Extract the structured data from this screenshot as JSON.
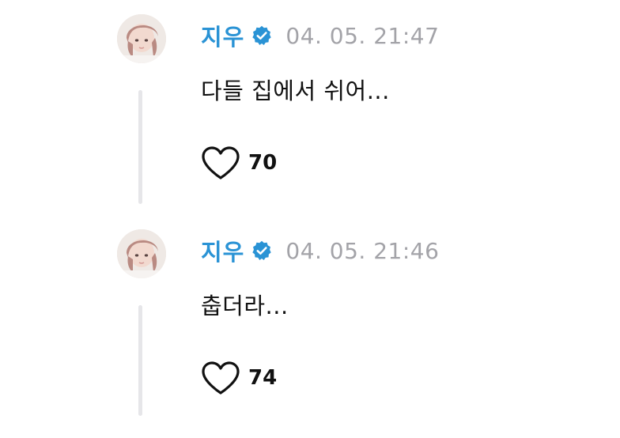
{
  "posts": [
    {
      "author": "지우",
      "verified_icon": "verified-badge-icon",
      "timestamp": "04. 05. 21:47",
      "text": "다들 집에서 쉬어...",
      "like_icon": "heart-outline-icon",
      "likes": "70"
    },
    {
      "author": "지우",
      "verified_icon": "verified-badge-icon",
      "timestamp": "04. 05. 21:46",
      "text": "춥더라...",
      "like_icon": "heart-outline-icon",
      "likes": "74"
    }
  ],
  "colors": {
    "username": "#2a93d5",
    "verified": "#2a93d5",
    "timestamp": "#a3a3a8",
    "thread_line": "#e6e6e9",
    "text": "#111111"
  }
}
